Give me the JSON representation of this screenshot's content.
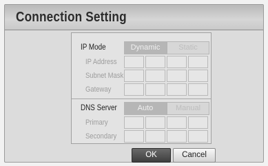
{
  "dialog": {
    "title": "Connection Setting"
  },
  "ip_mode": {
    "label": "IP Mode",
    "options": [
      "Dynamic",
      "Static"
    ],
    "selected": "Dynamic"
  },
  "ip_fields": [
    {
      "label": "IP Address"
    },
    {
      "label": "Subnet Mask"
    },
    {
      "label": "Gateway"
    }
  ],
  "dns_server": {
    "label": "DNS Server",
    "options": [
      "Auto",
      "Manual"
    ],
    "selected": "Auto"
  },
  "dns_fields": [
    {
      "label": "Primary"
    },
    {
      "label": "Secondary"
    }
  ],
  "buttons": {
    "ok": "OK",
    "cancel": "Cancel"
  }
}
